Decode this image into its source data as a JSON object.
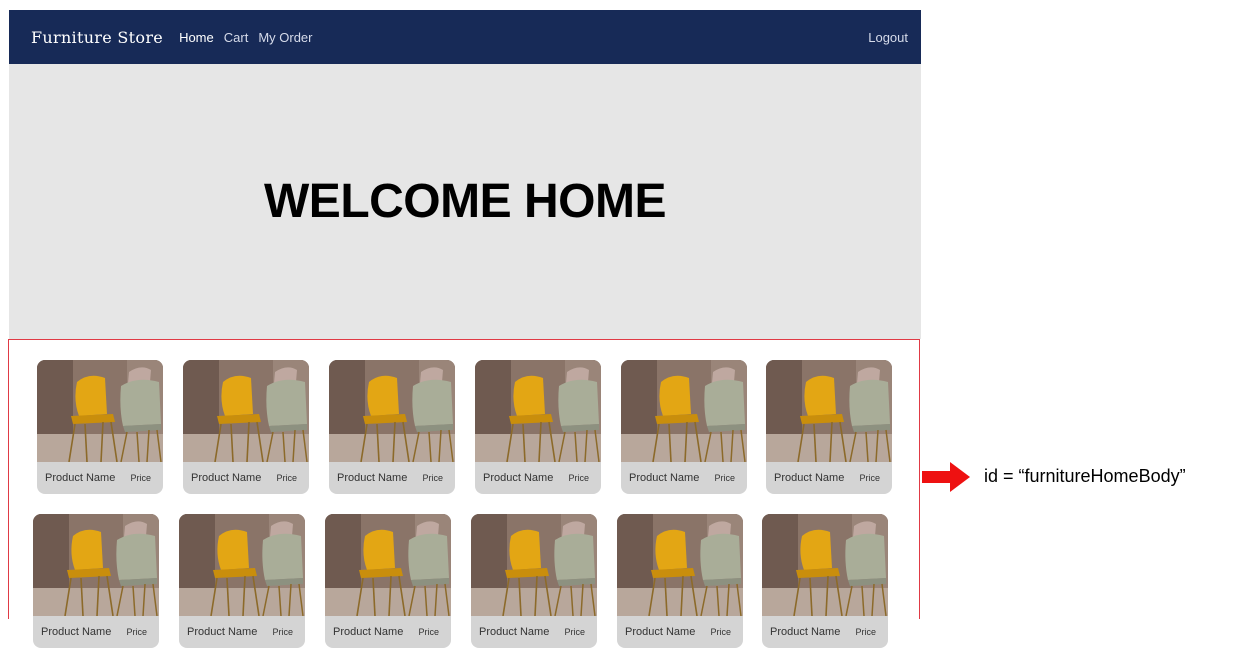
{
  "navbar": {
    "brand": "Furniture Store",
    "links": [
      {
        "label": "Home"
      },
      {
        "label": "Cart"
      },
      {
        "label": "My Order"
      }
    ],
    "logout": "Logout",
    "background": "#172a57"
  },
  "hero": {
    "title": "WELCOME HOME",
    "background": "#e6e6e6"
  },
  "product_grid": {
    "rows": [
      [
        {
          "name": "Product Name",
          "price": "Price"
        },
        {
          "name": "Product Name",
          "price": "Price"
        },
        {
          "name": "Product Name",
          "price": "Price"
        },
        {
          "name": "Product Name",
          "price": "Price"
        },
        {
          "name": "Product Name",
          "price": "Price"
        },
        {
          "name": "Product Name",
          "price": "Price"
        }
      ],
      [
        {
          "name": "Product Name",
          "price": "Price"
        },
        {
          "name": "Product Name",
          "price": "Price"
        },
        {
          "name": "Product Name",
          "price": "Price"
        },
        {
          "name": "Product Name",
          "price": "Price"
        },
        {
          "name": "Product Name",
          "price": "Price"
        },
        {
          "name": "Product Name",
          "price": "Price"
        }
      ]
    ],
    "highlight_color": "#e03a45"
  },
  "annotation": {
    "text": "id = “furnitureHomeBody”",
    "arrow_color": "#ee1111",
    "arrow_icon": "right-arrow-icon"
  }
}
